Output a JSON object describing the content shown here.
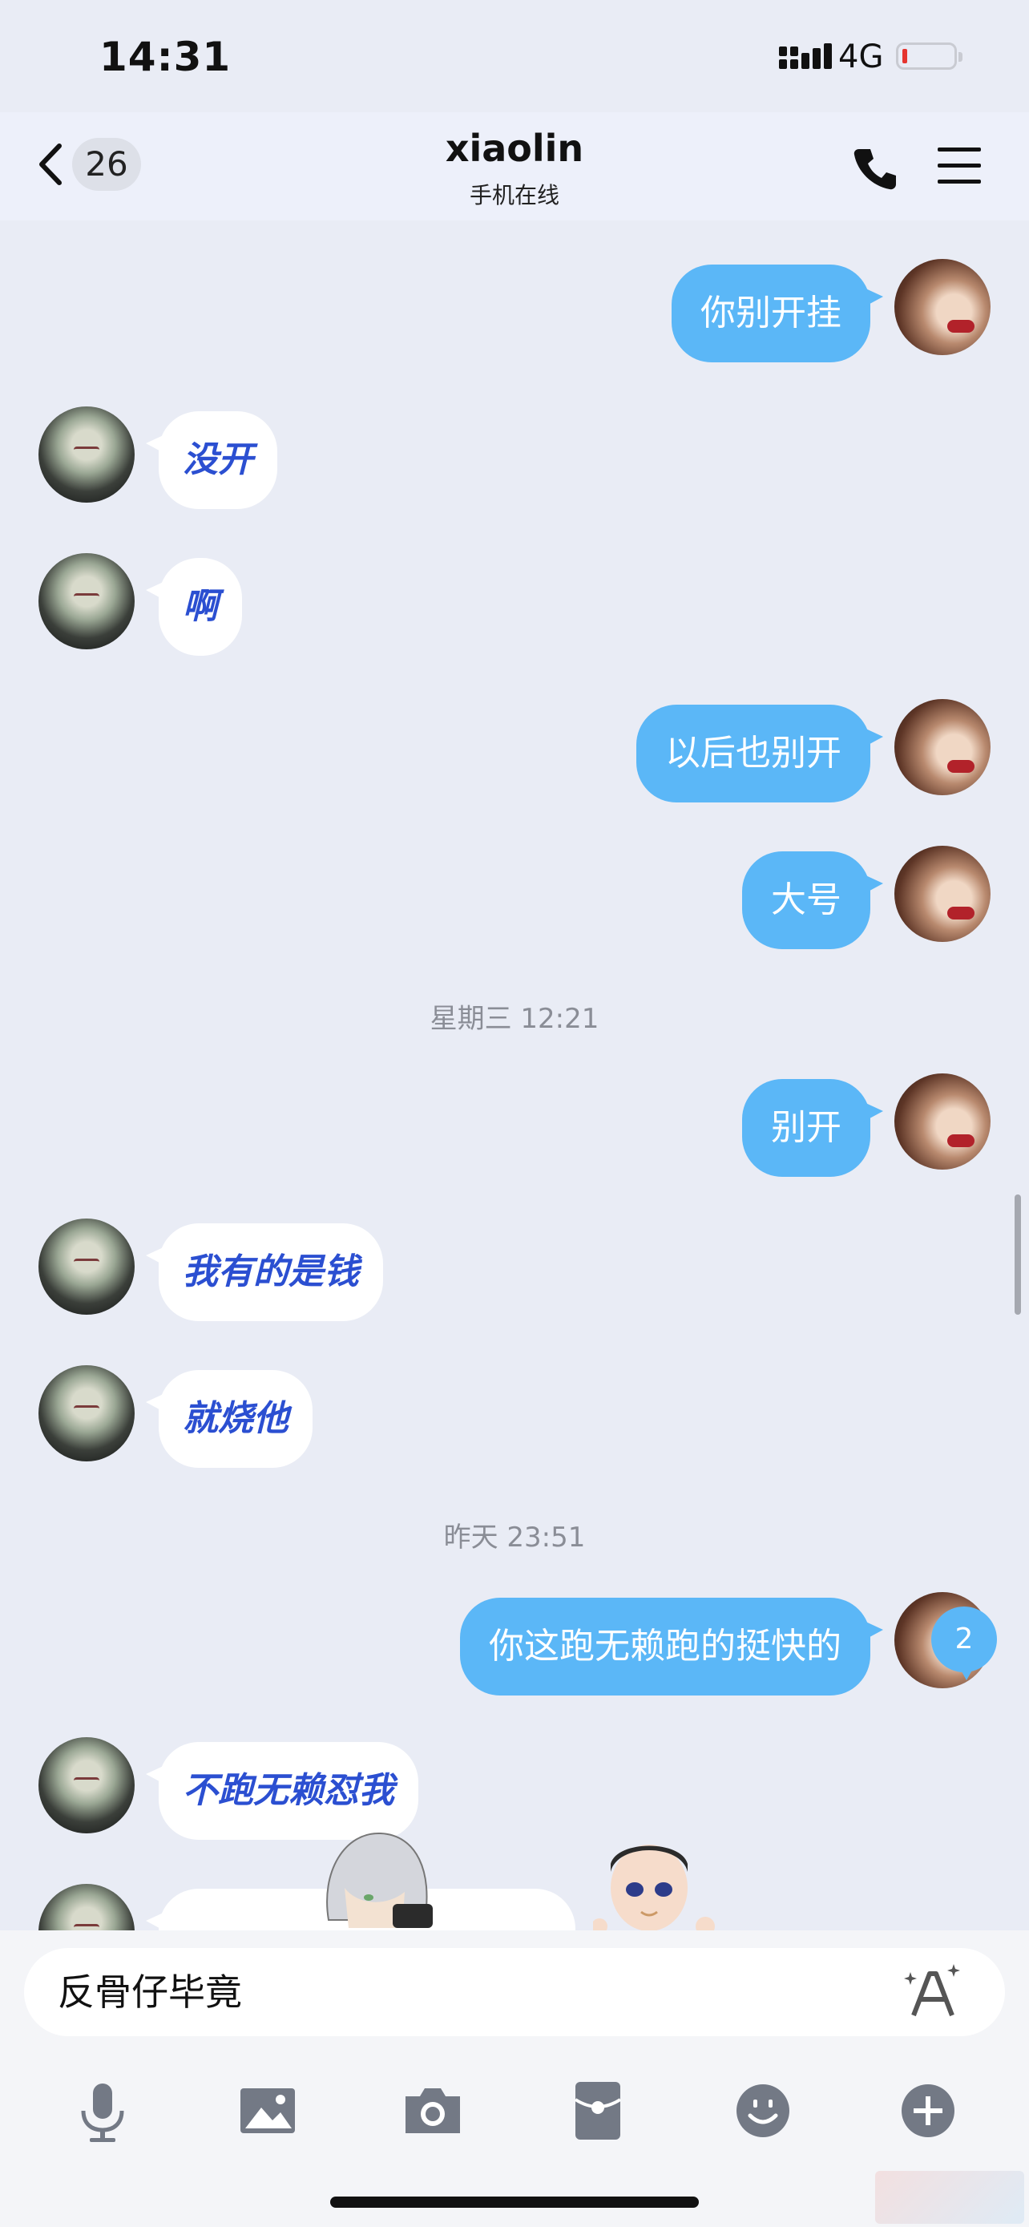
{
  "status_bar": {
    "time": "14:31",
    "network": "4G"
  },
  "header": {
    "unread_count": "26",
    "title": "xiaolin",
    "subtitle": "手机在线"
  },
  "messages": [
    {
      "side": "out",
      "text": "你别开挂"
    },
    {
      "side": "in",
      "text": "没开"
    },
    {
      "side": "in",
      "text": "啊"
    },
    {
      "side": "out",
      "text": "以后也别开"
    },
    {
      "side": "out",
      "text": "大号"
    },
    {
      "side": "out",
      "text": "别开"
    },
    {
      "side": "in",
      "text": "我有的是钱"
    },
    {
      "side": "in",
      "text": "就烧他"
    },
    {
      "side": "out",
      "text": "你这跑无赖跑的挺快的"
    },
    {
      "side": "in",
      "text": "不跑无赖怼我"
    }
  ],
  "timestamps": [
    "星期三 12:21",
    "昨天 23:51"
  ],
  "new_messages_badge": "2",
  "input": {
    "value": "反骨仔毕竟"
  },
  "icons": {
    "toolbar": [
      "microphone-icon",
      "image-icon",
      "camera-icon",
      "red-packet-icon",
      "emoji-icon",
      "plus-icon"
    ]
  },
  "colors": {
    "outgoing_bubble": "#5bb7f7",
    "incoming_text": "#2b4fd1",
    "background": "#e9ecf5"
  }
}
